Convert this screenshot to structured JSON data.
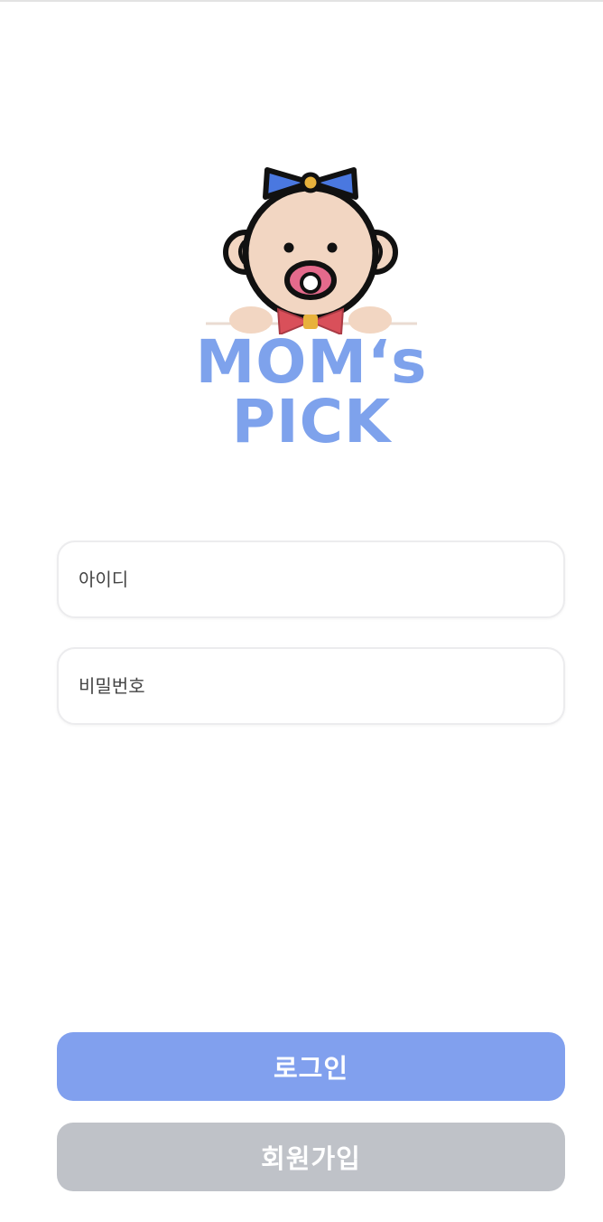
{
  "logo": {
    "text": "MOM‘s PICK",
    "icon": "baby-with-pacifier-and-bow-icon"
  },
  "form": {
    "id_placeholder": "아이디",
    "password_placeholder": "비밀번호"
  },
  "buttons": {
    "login_label": "로그인",
    "signup_label": "회원가입"
  },
  "colors": {
    "brand_blue": "#7ea2ec",
    "login_button": "#81a0ee",
    "signup_button": "#bfc2c8",
    "bow_blue": "#4a78e0",
    "bowtie_red": "#d9505a",
    "skin": "#f2d6c2"
  }
}
